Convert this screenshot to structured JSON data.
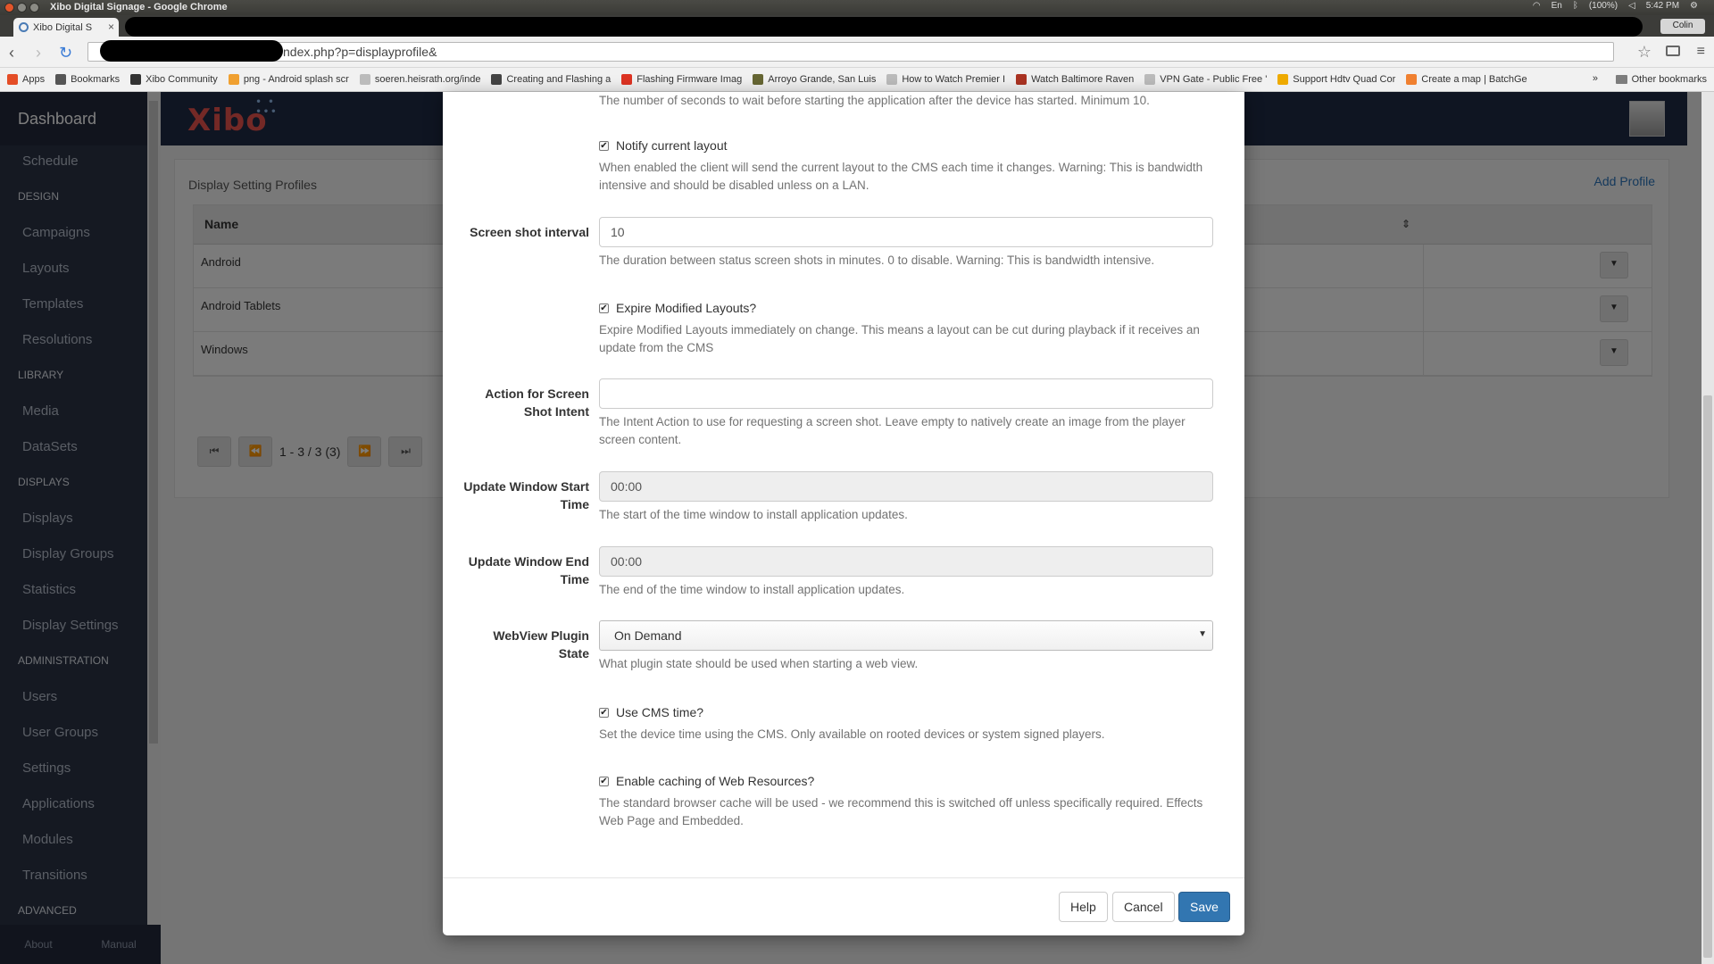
{
  "window": {
    "title": "Xibo Digital Signage - Google Chrome",
    "tab_title": "Xibo Digital S",
    "clock": "5:42 PM",
    "battery": "(100%)",
    "profile": "Colin",
    "url_visible": "ndex.php?p=displayprofile&"
  },
  "bookmarks": [
    {
      "label": "Apps",
      "color": "#e44d26"
    },
    {
      "label": "Bookmarks",
      "color": "#555555"
    },
    {
      "label": "Xibo Community",
      "color": "#333333"
    },
    {
      "label": "png - Android splash scr",
      "color": "#f0a030"
    },
    {
      "label": "soeren.heisrath.org/inde",
      "color": "#999999"
    },
    {
      "label": "Creating and Flashing a",
      "color": "#444444"
    },
    {
      "label": "Flashing Firmware Imag",
      "color": "#dd3322"
    },
    {
      "label": "Arroyo Grande, San Luis",
      "color": "#666633"
    },
    {
      "label": "How to Watch Premier I",
      "color": "#999999"
    },
    {
      "label": "Watch Baltimore Raven",
      "color": "#aa3322"
    },
    {
      "label": "VPN Gate - Public Free '",
      "color": "#999999"
    },
    {
      "label": "Support Hdtv Quad Cor",
      "color": "#eeaa00"
    },
    {
      "label": "Create a map | BatchGe",
      "color": "#f08030"
    }
  ],
  "bookmarks_other": "Other bookmarks",
  "sidebar": {
    "title": "Dashboard",
    "schedule": "Schedule",
    "design_head": "DESIGN",
    "campaigns": "Campaigns",
    "layouts": "Layouts",
    "templates": "Templates",
    "resolutions": "Resolutions",
    "library_head": "LIBRARY",
    "media": "Media",
    "datasets": "DataSets",
    "displays_head": "DISPLAYS",
    "displays": "Displays",
    "display_groups": "Display Groups",
    "statistics": "Statistics",
    "display_settings": "Display Settings",
    "admin_head": "ADMINISTRATION",
    "users": "Users",
    "user_groups": "User Groups",
    "settings": "Settings",
    "applications": "Applications",
    "modules": "Modules",
    "transitions": "Transitions",
    "advanced_head": "ADVANCED",
    "about": "About",
    "manual": "Manual"
  },
  "brand": {
    "logo": "Xibo",
    "logo_color": "#e9524c"
  },
  "panel": {
    "title": "Display Setting Profiles",
    "add_profile": "Add Profile",
    "column_name": "Name",
    "rows": [
      "Android",
      "Android Tablets",
      "Windows"
    ],
    "pager": "1 - 3 / 3 (3)"
  },
  "modal": {
    "startup_help": "The number of seconds to wait before starting the application after the device has started. Minimum 10.",
    "notify_label": "Notify current layout",
    "notify_help": "When enabled the client will send the current layout to the CMS each time it changes. Warning: This is bandwidth intensive and should be disabled unless on a LAN.",
    "screenshot_label": "Screen shot interval",
    "screenshot_value": "10",
    "screenshot_help": "The duration between status screen shots in minutes. 0 to disable. Warning: This is bandwidth intensive.",
    "expire_label": "Expire Modified Layouts?",
    "expire_help": "Expire Modified Layouts immediately on change. This means a layout can be cut during playback if it receives an update from the CMS",
    "intent_label": "Action for Screen Shot Intent",
    "intent_value": "",
    "intent_help": "The Intent Action to use for requesting a screen shot. Leave empty to natively create an image from the player screen content.",
    "update_start_label": "Update Window Start Time",
    "update_start_value": "00:00",
    "update_start_help": "The start of the time window to install application updates.",
    "update_end_label": "Update Window End Time",
    "update_end_value": "00:00",
    "update_end_help": "The end of the time window to install application updates.",
    "webview_label": "WebView Plugin State",
    "webview_value": "On Demand",
    "webview_help": "What plugin state should be used when starting a web view.",
    "cms_time_label": "Use CMS time?",
    "cms_time_help": "Set the device time using the CMS. Only available on rooted devices or system signed players.",
    "cache_label": "Enable caching of Web Resources?",
    "cache_help": "The standard browser cache will be used - we recommend this is switched off unless specifically required. Effects Web Page and Embedded.",
    "help_btn": "Help",
    "cancel_btn": "Cancel",
    "save_btn": "Save"
  }
}
